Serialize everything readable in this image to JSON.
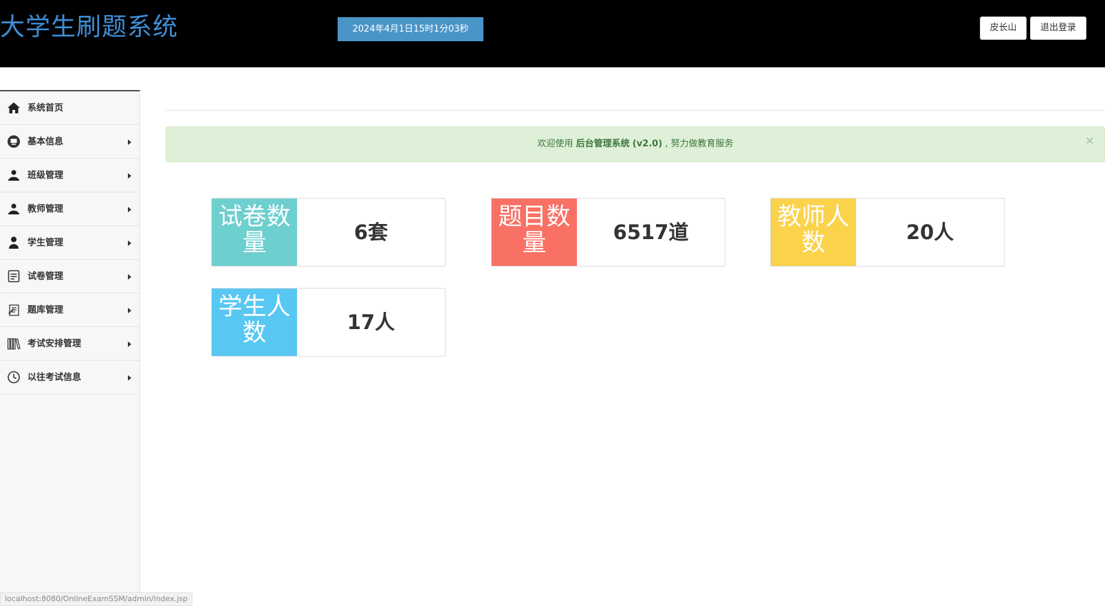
{
  "header": {
    "title": "大学生刷题系统",
    "clock": "2024年4月1日15时1分03秒",
    "user_button": "皮长山",
    "logout_button": "退出登录"
  },
  "sidebar": {
    "items": [
      {
        "label": "系统首页",
        "icon": "home-icon",
        "has_submenu": false
      },
      {
        "label": "基本信息",
        "icon": "monitor-icon",
        "has_submenu": true
      },
      {
        "label": "班级管理",
        "icon": "users-icon",
        "has_submenu": true
      },
      {
        "label": "教师管理",
        "icon": "users-icon",
        "has_submenu": true
      },
      {
        "label": "学生管理",
        "icon": "user-icon",
        "has_submenu": true
      },
      {
        "label": "试卷管理",
        "icon": "document-icon",
        "has_submenu": true
      },
      {
        "label": "题库管理",
        "icon": "notebook-icon",
        "has_submenu": true
      },
      {
        "label": "考试安排管理",
        "icon": "books-icon",
        "has_submenu": true
      },
      {
        "label": "以往考试信息",
        "icon": "clock-icon",
        "has_submenu": true
      }
    ]
  },
  "alert": {
    "prefix": "欢迎使用",
    "system_name": "后台管理系统",
    "version": "(v2.0)",
    "suffix": ", 努力做教育服务",
    "close": "×"
  },
  "stats": [
    {
      "label": "试卷数量",
      "value": "6套",
      "color": "#6ecfcf"
    },
    {
      "label": "题目数量",
      "value": "6517道",
      "color": "#f97065"
    },
    {
      "label": "教师人数",
      "value": "20人",
      "color": "#fbd24b"
    },
    {
      "label": "学生人数",
      "value": "17人",
      "color": "#58c7f2"
    }
  ],
  "statusbar": {
    "url": "localhost:8080/OnlineExamSSM/admin/index.jsp"
  },
  "colors": {
    "header_bg": "#000000",
    "brand": "#3e8ed6",
    "clock_bg": "#4a95c8",
    "alert_bg": "#dff0d8",
    "alert_text": "#3c763d"
  }
}
